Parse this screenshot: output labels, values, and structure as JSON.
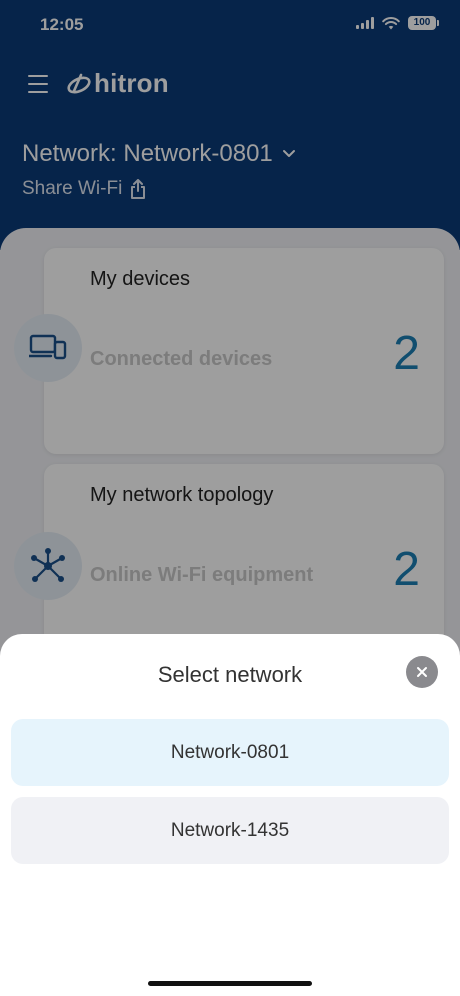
{
  "status_bar": {
    "time": "12:05",
    "battery": "100"
  },
  "header": {
    "brand": "hitron",
    "network_label": "Network: Network-0801",
    "share_label": "Share Wi-Fi"
  },
  "cards": [
    {
      "title": "My devices",
      "subtitle": "Connected devices",
      "count": "2",
      "icon": "devices-icon"
    },
    {
      "title": "My network topology",
      "subtitle": "Online Wi-Fi equipment",
      "count": "2",
      "icon": "topology-icon"
    }
  ],
  "sheet": {
    "title": "Select network",
    "options": [
      {
        "label": "Network-0801",
        "selected": true
      },
      {
        "label": "Network-1435",
        "selected": false
      }
    ]
  },
  "colors": {
    "header_bg": "#0a3a78",
    "accent": "#1c7fb3",
    "selected_bg": "#e6f4fc"
  }
}
